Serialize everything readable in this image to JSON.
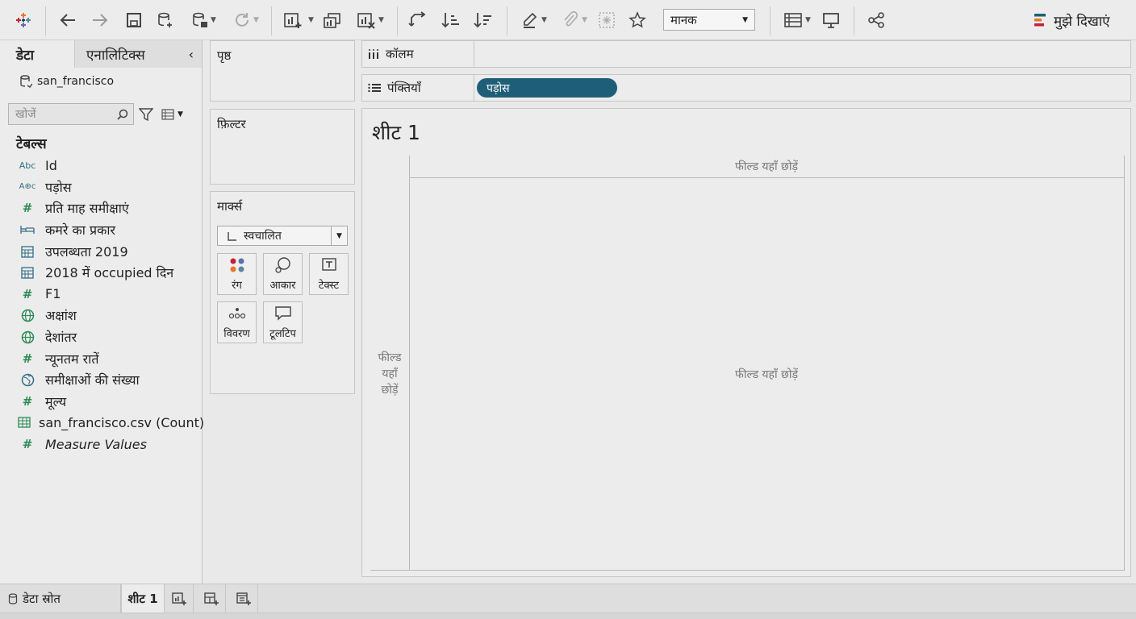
{
  "toolbar": {
    "standard_fit": "मानक",
    "show_me": "मुझे दिखाएं"
  },
  "data_pane": {
    "tab_data": "डेटा",
    "tab_analytics": "एनालिटिक्स",
    "datasource": "san_francisco",
    "search_placeholder": "खोजें",
    "tables_heading": "टेबल्स",
    "fields": [
      {
        "icon": "Abc",
        "label": "Id"
      },
      {
        "icon": "Abc",
        "label": "पड़ोस"
      },
      {
        "icon": "#",
        "label": "प्रति माह समीक्षाएं"
      },
      {
        "icon": "bed-icon",
        "label": "कमरे का प्रकार"
      },
      {
        "icon": "calendar-icon",
        "label": "उपलब्धता 2019"
      },
      {
        "icon": "calendar-icon",
        "label": "2018 में occupied दिन"
      },
      {
        "icon": "#",
        "label": "F1"
      },
      {
        "icon": "globe-icon",
        "label": "अक्षांश"
      },
      {
        "icon": "globe-icon",
        "label": "देशांतर"
      },
      {
        "icon": "#",
        "label": "न्यूनतम रातें"
      },
      {
        "icon": "globe-icon",
        "label": "समीक्षाओं की संख्या"
      },
      {
        "icon": "#",
        "label": "मूल्य"
      },
      {
        "icon": "table-icon",
        "label": "san_francisco.csv (Count)"
      },
      {
        "icon": "#",
        "label": "Measure Values"
      }
    ]
  },
  "cards": {
    "pages": "पृष्ठ",
    "filters": "फ़िल्टर",
    "marks": "मार्क्स",
    "mark_type": "स्वचालित",
    "color": "रंग",
    "size": "आकार",
    "text": "टेक्स्ट",
    "detail": "विवरण",
    "tooltip": "टूलटिप"
  },
  "shelves": {
    "columns": "कॉलम",
    "rows": "पंक्तियाँ",
    "rows_pill": "पड़ोस"
  },
  "canvas": {
    "sheet_title": "शीट 1",
    "drop_top": "फील्ड यहाँ छोड़ें",
    "drop_left_1": "फील्ड",
    "drop_left_2": "यहाँ",
    "drop_left_3": "छोड़ें",
    "drop_center": "फील्ड यहाँ छोड़ें"
  },
  "bottom": {
    "datasource_tab": "डेटा स्रोत",
    "sheet_tab": "शीट 1"
  },
  "colors": {
    "pill": "#1f5e78",
    "dimension_icon": "#2f6f86",
    "measure_icon": "#2e8b57"
  }
}
